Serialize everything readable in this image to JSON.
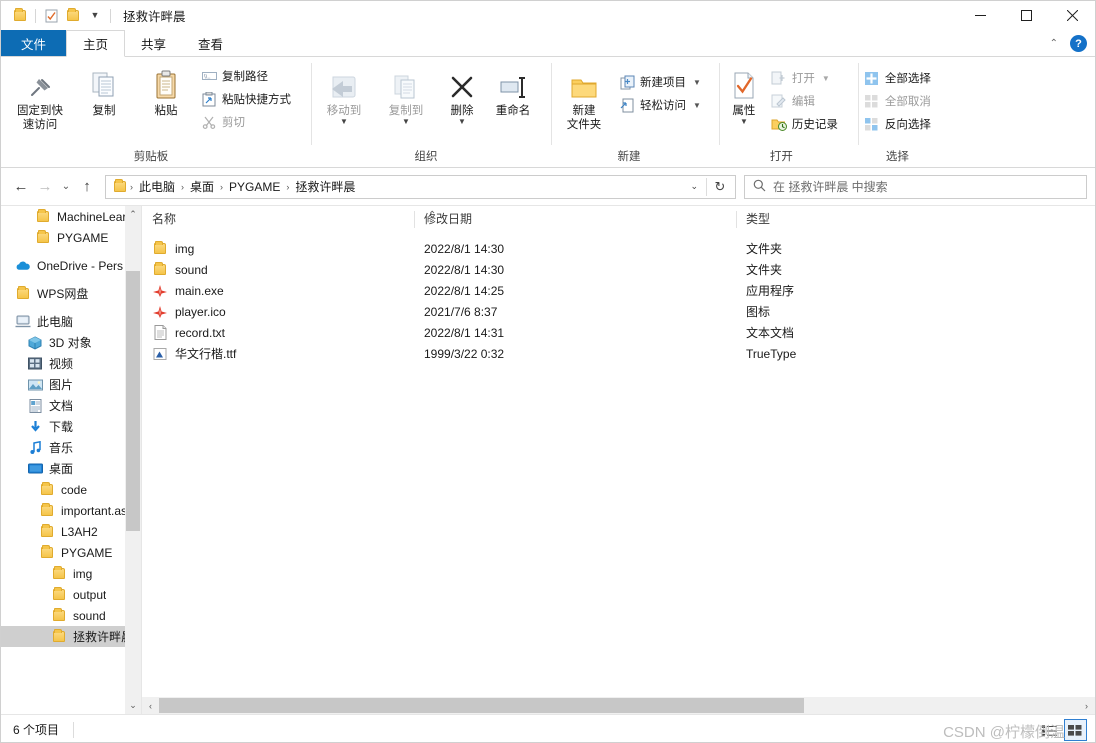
{
  "window": {
    "title": "拯救许畔晨",
    "quick_access": [
      "folder-icon",
      "properties-icon",
      "new-folder-icon",
      "customize-caret-icon"
    ],
    "controls": {
      "minimize": "—",
      "maximize": "☐",
      "close": "✕"
    }
  },
  "ribbon": {
    "tabs": [
      {
        "label": "文件",
        "state": "file"
      },
      {
        "label": "主页",
        "state": "active"
      },
      {
        "label": "共享",
        "state": "normal"
      },
      {
        "label": "查看",
        "state": "normal"
      }
    ],
    "collapse_caret": "⌃",
    "help_label": "?",
    "groups": [
      {
        "name": "clipboard",
        "label": "剪贴板",
        "big_buttons": [
          {
            "name": "pin-to-quick-access",
            "label": "固定到快\n速访问",
            "line1": "固定到快",
            "line2": "速访问",
            "icon": "pin-icon",
            "disabled": false
          },
          {
            "name": "copy",
            "label": "复制",
            "line1": "复制",
            "line2": "",
            "icon": "copy-icon",
            "disabled": false
          },
          {
            "name": "paste",
            "label": "粘贴",
            "line1": "粘贴",
            "line2": "",
            "icon": "paste-icon",
            "disabled": false
          }
        ],
        "small_buttons": [
          {
            "name": "copy-path",
            "label": "复制路径",
            "icon": "copy-path-icon",
            "disabled": false
          },
          {
            "name": "paste-shortcut",
            "label": "粘贴快捷方式",
            "icon": "paste-shortcut-icon",
            "disabled": false
          },
          {
            "name": "cut",
            "label": "剪切",
            "icon": "scissors-icon",
            "disabled": true
          }
        ]
      },
      {
        "name": "organize",
        "label": "组织",
        "big_buttons": [
          {
            "name": "move-to",
            "label": "移动到",
            "line1": "移动到",
            "line2": "",
            "icon": "move-to-icon",
            "disabled": true,
            "caret": true
          },
          {
            "name": "copy-to",
            "label": "复制到",
            "line1": "复制到",
            "line2": "",
            "icon": "copy-to-icon",
            "disabled": true,
            "caret": true
          },
          {
            "name": "delete",
            "label": "删除",
            "line1": "删除",
            "line2": "",
            "icon": "delete-x-icon",
            "disabled": false,
            "caret": true
          },
          {
            "name": "rename",
            "label": "重命名",
            "line1": "重命名",
            "line2": "",
            "icon": "rename-icon",
            "disabled": false
          }
        ],
        "small_buttons": []
      },
      {
        "name": "new",
        "label": "新建",
        "big_buttons": [
          {
            "name": "new-folder",
            "label": "新建文件夹",
            "line1": "新建",
            "line2": "文件夹",
            "icon": "new-folder-icon",
            "disabled": false
          }
        ],
        "small_buttons": [
          {
            "name": "new-item",
            "label": "新建项目",
            "icon": "new-item-icon",
            "disabled": false,
            "caret": true
          },
          {
            "name": "easy-access",
            "label": "轻松访问",
            "icon": "easy-access-icon",
            "disabled": false,
            "caret": true
          }
        ]
      },
      {
        "name": "open",
        "label": "打开",
        "big_buttons": [
          {
            "name": "properties",
            "label": "属性",
            "line1": "属性",
            "line2": "",
            "icon": "properties-icon",
            "disabled": false,
            "caret": true
          }
        ],
        "small_buttons": [
          {
            "name": "open-file",
            "label": "打开",
            "icon": "open-icon",
            "disabled": true,
            "caret": true
          },
          {
            "name": "edit",
            "label": "编辑",
            "icon": "edit-icon",
            "disabled": true
          },
          {
            "name": "history",
            "label": "历史记录",
            "icon": "history-icon",
            "disabled": false
          }
        ]
      },
      {
        "name": "select",
        "label": "选择",
        "big_buttons": [],
        "small_buttons": [
          {
            "name": "select-all",
            "label": "全部选择",
            "icon": "select-all-icon",
            "disabled": false
          },
          {
            "name": "select-none",
            "label": "全部取消",
            "icon": "select-none-icon",
            "disabled": true
          },
          {
            "name": "invert-selection",
            "label": "反向选择",
            "icon": "invert-selection-icon",
            "disabled": false
          }
        ]
      }
    ]
  },
  "navbar": {
    "back": "←",
    "forward": "→",
    "recent_caret": "⌄",
    "up": "↑",
    "breadcrumbs": [
      "此电脑",
      "桌面",
      "PYGAME",
      "拯救许畔晨"
    ],
    "separator": "›",
    "dropdown_caret": "⌄",
    "refresh_icon": "refresh-icon",
    "search": {
      "placeholder": "在 拯救许畔晨 中搜索",
      "icon": "search-icon"
    }
  },
  "sidebar": {
    "items": [
      {
        "label": "MachineLearnin",
        "icon": "folder-icon",
        "indent": 2,
        "selected": false
      },
      {
        "label": "PYGAME",
        "icon": "folder-icon",
        "indent": 2,
        "selected": false
      },
      {
        "label": "",
        "icon": "spacer",
        "indent": 0,
        "selected": false,
        "spacer": true
      },
      {
        "label": "OneDrive - Pers",
        "icon": "onedrive-icon",
        "indent": 1,
        "selected": false
      },
      {
        "label": "",
        "icon": "spacer",
        "indent": 0,
        "selected": false,
        "spacer": true
      },
      {
        "label": "WPS网盘",
        "icon": "folder-icon",
        "indent": 1,
        "selected": false
      },
      {
        "label": "",
        "icon": "spacer",
        "indent": 0,
        "selected": false,
        "spacer": true
      },
      {
        "label": "此电脑",
        "icon": "this-pc-icon",
        "indent": 1,
        "selected": false
      },
      {
        "label": "3D 对象",
        "icon": "3d-objects-icon",
        "indent": 2,
        "selected": false
      },
      {
        "label": "视频",
        "icon": "videos-icon",
        "indent": 2,
        "selected": false
      },
      {
        "label": "图片",
        "icon": "pictures-icon",
        "indent": 2,
        "selected": false
      },
      {
        "label": "文档",
        "icon": "documents-icon",
        "indent": 2,
        "selected": false
      },
      {
        "label": "下载",
        "icon": "downloads-icon",
        "indent": 2,
        "selected": false
      },
      {
        "label": "音乐",
        "icon": "music-icon",
        "indent": 2,
        "selected": false
      },
      {
        "label": "桌面",
        "icon": "desktop-icon",
        "indent": 2,
        "selected": false
      },
      {
        "label": "code",
        "icon": "folder-icon",
        "indent": 3,
        "selected": false
      },
      {
        "label": "important.ass",
        "icon": "folder-icon",
        "indent": 3,
        "selected": false
      },
      {
        "label": "L3AH2",
        "icon": "folder-icon",
        "indent": 3,
        "selected": false
      },
      {
        "label": "PYGAME",
        "icon": "folder-icon",
        "indent": 3,
        "selected": false
      },
      {
        "label": "img",
        "icon": "folder-icon",
        "indent": 4,
        "selected": false
      },
      {
        "label": "output",
        "icon": "folder-icon",
        "indent": 4,
        "selected": false
      },
      {
        "label": "sound",
        "icon": "folder-icon",
        "indent": 4,
        "selected": false
      },
      {
        "label": "拯救许畔晨",
        "icon": "folder-icon",
        "indent": 4,
        "selected": true
      }
    ],
    "scroll": {
      "up_arrow": "⌃",
      "down_arrow": "⌄"
    }
  },
  "filelist": {
    "columns": [
      {
        "key": "name",
        "label": "名称",
        "sorted": "asc"
      },
      {
        "key": "date",
        "label": "修改日期",
        "sorted": ""
      },
      {
        "key": "type",
        "label": "类型",
        "sorted": ""
      }
    ],
    "sort_caret": "⌃",
    "rows": [
      {
        "name": "img",
        "date": "2022/8/1 14:30",
        "type": "文件夹",
        "icon": "folder-icon"
      },
      {
        "name": "sound",
        "date": "2022/8/1 14:30",
        "type": "文件夹",
        "icon": "folder-icon"
      },
      {
        "name": "main.exe",
        "date": "2022/8/1 14:25",
        "type": "应用程序",
        "icon": "app-plane-icon"
      },
      {
        "name": "player.ico",
        "date": "2021/7/6 8:37",
        "type": "图标",
        "icon": "app-plane-icon"
      },
      {
        "name": "record.txt",
        "date": "2022/8/1 14:31",
        "type": "文本文档",
        "icon": "text-file-icon"
      },
      {
        "name": "华文行楷.ttf",
        "date": "1999/3/22 0:32",
        "type": "TrueType",
        "icon": "font-file-icon"
      }
    ],
    "hscroll": {
      "left_arrow": "‹",
      "right_arrow": "›"
    }
  },
  "statusbar": {
    "item_count": "6 个项目",
    "views": [
      {
        "name": "details-view",
        "icon": "details-view-icon",
        "active": false
      },
      {
        "name": "large-icons-view",
        "icon": "large-icons-view-icon",
        "active": true
      }
    ]
  },
  "watermark": "CSDN @柠檬倒温"
}
